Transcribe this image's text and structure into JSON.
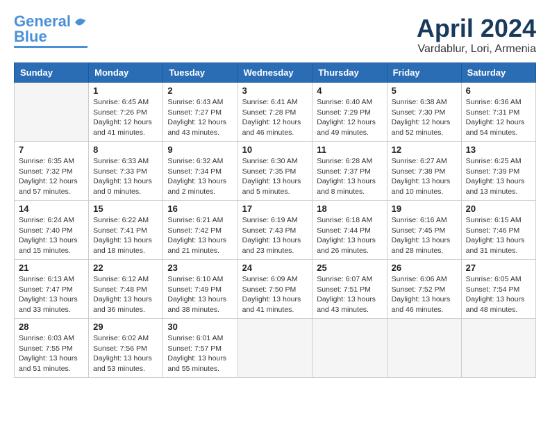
{
  "header": {
    "logo_general": "General",
    "logo_blue": "Blue",
    "month_title": "April 2024",
    "location": "Vardablur, Lori, Armenia"
  },
  "days_of_week": [
    "Sunday",
    "Monday",
    "Tuesday",
    "Wednesday",
    "Thursday",
    "Friday",
    "Saturday"
  ],
  "weeks": [
    [
      {
        "day": "",
        "sunrise": "",
        "sunset": "",
        "daylight": ""
      },
      {
        "day": "1",
        "sunrise": "Sunrise: 6:45 AM",
        "sunset": "Sunset: 7:26 PM",
        "daylight": "Daylight: 12 hours and 41 minutes."
      },
      {
        "day": "2",
        "sunrise": "Sunrise: 6:43 AM",
        "sunset": "Sunset: 7:27 PM",
        "daylight": "Daylight: 12 hours and 43 minutes."
      },
      {
        "day": "3",
        "sunrise": "Sunrise: 6:41 AM",
        "sunset": "Sunset: 7:28 PM",
        "daylight": "Daylight: 12 hours and 46 minutes."
      },
      {
        "day": "4",
        "sunrise": "Sunrise: 6:40 AM",
        "sunset": "Sunset: 7:29 PM",
        "daylight": "Daylight: 12 hours and 49 minutes."
      },
      {
        "day": "5",
        "sunrise": "Sunrise: 6:38 AM",
        "sunset": "Sunset: 7:30 PM",
        "daylight": "Daylight: 12 hours and 52 minutes."
      },
      {
        "day": "6",
        "sunrise": "Sunrise: 6:36 AM",
        "sunset": "Sunset: 7:31 PM",
        "daylight": "Daylight: 12 hours and 54 minutes."
      }
    ],
    [
      {
        "day": "7",
        "sunrise": "Sunrise: 6:35 AM",
        "sunset": "Sunset: 7:32 PM",
        "daylight": "Daylight: 12 hours and 57 minutes."
      },
      {
        "day": "8",
        "sunrise": "Sunrise: 6:33 AM",
        "sunset": "Sunset: 7:33 PM",
        "daylight": "Daylight: 13 hours and 0 minutes."
      },
      {
        "day": "9",
        "sunrise": "Sunrise: 6:32 AM",
        "sunset": "Sunset: 7:34 PM",
        "daylight": "Daylight: 13 hours and 2 minutes."
      },
      {
        "day": "10",
        "sunrise": "Sunrise: 6:30 AM",
        "sunset": "Sunset: 7:35 PM",
        "daylight": "Daylight: 13 hours and 5 minutes."
      },
      {
        "day": "11",
        "sunrise": "Sunrise: 6:28 AM",
        "sunset": "Sunset: 7:37 PM",
        "daylight": "Daylight: 13 hours and 8 minutes."
      },
      {
        "day": "12",
        "sunrise": "Sunrise: 6:27 AM",
        "sunset": "Sunset: 7:38 PM",
        "daylight": "Daylight: 13 hours and 10 minutes."
      },
      {
        "day": "13",
        "sunrise": "Sunrise: 6:25 AM",
        "sunset": "Sunset: 7:39 PM",
        "daylight": "Daylight: 13 hours and 13 minutes."
      }
    ],
    [
      {
        "day": "14",
        "sunrise": "Sunrise: 6:24 AM",
        "sunset": "Sunset: 7:40 PM",
        "daylight": "Daylight: 13 hours and 15 minutes."
      },
      {
        "day": "15",
        "sunrise": "Sunrise: 6:22 AM",
        "sunset": "Sunset: 7:41 PM",
        "daylight": "Daylight: 13 hours and 18 minutes."
      },
      {
        "day": "16",
        "sunrise": "Sunrise: 6:21 AM",
        "sunset": "Sunset: 7:42 PM",
        "daylight": "Daylight: 13 hours and 21 minutes."
      },
      {
        "day": "17",
        "sunrise": "Sunrise: 6:19 AM",
        "sunset": "Sunset: 7:43 PM",
        "daylight": "Daylight: 13 hours and 23 minutes."
      },
      {
        "day": "18",
        "sunrise": "Sunrise: 6:18 AM",
        "sunset": "Sunset: 7:44 PM",
        "daylight": "Daylight: 13 hours and 26 minutes."
      },
      {
        "day": "19",
        "sunrise": "Sunrise: 6:16 AM",
        "sunset": "Sunset: 7:45 PM",
        "daylight": "Daylight: 13 hours and 28 minutes."
      },
      {
        "day": "20",
        "sunrise": "Sunrise: 6:15 AM",
        "sunset": "Sunset: 7:46 PM",
        "daylight": "Daylight: 13 hours and 31 minutes."
      }
    ],
    [
      {
        "day": "21",
        "sunrise": "Sunrise: 6:13 AM",
        "sunset": "Sunset: 7:47 PM",
        "daylight": "Daylight: 13 hours and 33 minutes."
      },
      {
        "day": "22",
        "sunrise": "Sunrise: 6:12 AM",
        "sunset": "Sunset: 7:48 PM",
        "daylight": "Daylight: 13 hours and 36 minutes."
      },
      {
        "day": "23",
        "sunrise": "Sunrise: 6:10 AM",
        "sunset": "Sunset: 7:49 PM",
        "daylight": "Daylight: 13 hours and 38 minutes."
      },
      {
        "day": "24",
        "sunrise": "Sunrise: 6:09 AM",
        "sunset": "Sunset: 7:50 PM",
        "daylight": "Daylight: 13 hours and 41 minutes."
      },
      {
        "day": "25",
        "sunrise": "Sunrise: 6:07 AM",
        "sunset": "Sunset: 7:51 PM",
        "daylight": "Daylight: 13 hours and 43 minutes."
      },
      {
        "day": "26",
        "sunrise": "Sunrise: 6:06 AM",
        "sunset": "Sunset: 7:52 PM",
        "daylight": "Daylight: 13 hours and 46 minutes."
      },
      {
        "day": "27",
        "sunrise": "Sunrise: 6:05 AM",
        "sunset": "Sunset: 7:54 PM",
        "daylight": "Daylight: 13 hours and 48 minutes."
      }
    ],
    [
      {
        "day": "28",
        "sunrise": "Sunrise: 6:03 AM",
        "sunset": "Sunset: 7:55 PM",
        "daylight": "Daylight: 13 hours and 51 minutes."
      },
      {
        "day": "29",
        "sunrise": "Sunrise: 6:02 AM",
        "sunset": "Sunset: 7:56 PM",
        "daylight": "Daylight: 13 hours and 53 minutes."
      },
      {
        "day": "30",
        "sunrise": "Sunrise: 6:01 AM",
        "sunset": "Sunset: 7:57 PM",
        "daylight": "Daylight: 13 hours and 55 minutes."
      },
      {
        "day": "",
        "sunrise": "",
        "sunset": "",
        "daylight": ""
      },
      {
        "day": "",
        "sunrise": "",
        "sunset": "",
        "daylight": ""
      },
      {
        "day": "",
        "sunrise": "",
        "sunset": "",
        "daylight": ""
      },
      {
        "day": "",
        "sunrise": "",
        "sunset": "",
        "daylight": ""
      }
    ]
  ]
}
